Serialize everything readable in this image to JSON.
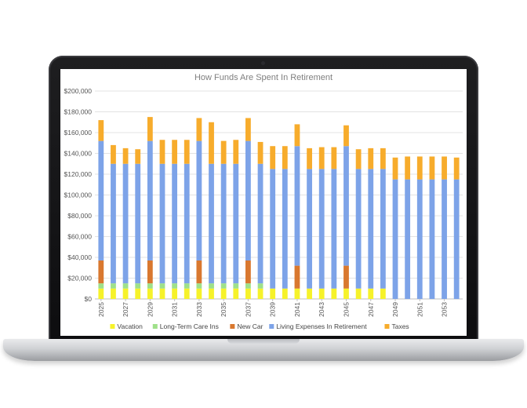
{
  "chart_data": {
    "type": "bar",
    "stacked": true,
    "title": "How Funds Are Spent In Retirement",
    "ylim": [
      0,
      200000
    ],
    "yticks": [
      0,
      20000,
      40000,
      60000,
      80000,
      100000,
      120000,
      140000,
      160000,
      180000,
      200000
    ],
    "ytick_labels": [
      "$0",
      "$20,000",
      "$40,000",
      "$60,000",
      "$80,000",
      "$100,000",
      "$120,000",
      "$140,000",
      "$160,000",
      "$180,000",
      "$200,000"
    ],
    "grid": true,
    "legend_position": "bottom",
    "categories": [
      "2025",
      "2026",
      "2027",
      "2028",
      "2029",
      "2030",
      "2031",
      "2032",
      "2033",
      "2034",
      "2035",
      "2036",
      "2037",
      "2038",
      "2039",
      "2040",
      "2041",
      "2042",
      "2043",
      "2044",
      "2045",
      "2046",
      "2047",
      "2048",
      "2049",
      "2050",
      "2051",
      "2052",
      "2053",
      "2054"
    ],
    "xtick_labels": [
      "2025",
      "2027",
      "2029",
      "2031",
      "2033",
      "2035",
      "2037",
      "2039",
      "2041",
      "2043",
      "2045",
      "2047",
      "2049",
      "2051",
      "2053"
    ],
    "series": [
      {
        "name": "Vacation",
        "color": "#f6f22a",
        "values": [
          10000,
          10000,
          10000,
          10000,
          10000,
          10000,
          10000,
          10000,
          10000,
          10000,
          10000,
          10000,
          10000,
          10000,
          10000,
          10000,
          10000,
          10000,
          10000,
          10000,
          10000,
          10000,
          10000,
          10000,
          0,
          0,
          0,
          0,
          0,
          0
        ]
      },
      {
        "name": "Long-Term Care Ins",
        "color": "#9fe08a",
        "values": [
          5000,
          5000,
          5000,
          5000,
          5000,
          5000,
          5000,
          5000,
          5000,
          5000,
          5000,
          5000,
          5000,
          5000,
          0,
          0,
          0,
          0,
          0,
          0,
          0,
          0,
          0,
          0,
          0,
          0,
          0,
          0,
          0,
          0
        ]
      },
      {
        "name": "New Car",
        "color": "#d9782f",
        "values": [
          22000,
          0,
          0,
          0,
          22000,
          0,
          0,
          0,
          22000,
          0,
          0,
          0,
          22000,
          0,
          0,
          0,
          22000,
          0,
          0,
          0,
          22000,
          0,
          0,
          0,
          0,
          0,
          0,
          0,
          0,
          0
        ]
      },
      {
        "name": "Living Expenses In Retirement",
        "color": "#7da3e8",
        "values": [
          115000,
          115000,
          115000,
          115000,
          115000,
          115000,
          115000,
          115000,
          115000,
          115000,
          115000,
          115000,
          115000,
          115000,
          115000,
          115000,
          115000,
          115000,
          115000,
          115000,
          115000,
          115000,
          115000,
          115000,
          115000,
          115000,
          115000,
          115000,
          115000,
          115000
        ]
      },
      {
        "name": "Taxes",
        "color": "#f7ac2c",
        "values": [
          20000,
          18000,
          15000,
          14000,
          23000,
          23000,
          23000,
          23000,
          22000,
          40000,
          22000,
          23000,
          22000,
          21000,
          22000,
          22000,
          21000,
          20000,
          21000,
          21000,
          20000,
          19000,
          20000,
          20000,
          21000,
          22000,
          22000,
          22000,
          22000,
          21000
        ]
      }
    ]
  }
}
